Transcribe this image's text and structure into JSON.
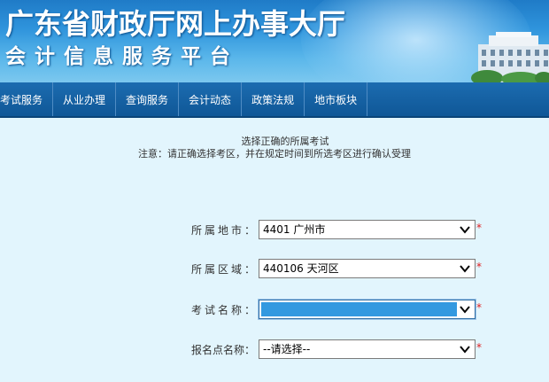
{
  "banner": {
    "title_main": "广东省财政厅网上办事大厅",
    "title_sub": "会计信息服务平台"
  },
  "nav": {
    "items": [
      "考试服务",
      "从业办理",
      "查询服务",
      "会计动态",
      "政策法规",
      "地市板块"
    ]
  },
  "notice": {
    "title": "选择正确的所属考试",
    "note": "注意：请正确选择考区，并在规定时间到所选考区进行确认受理"
  },
  "form": {
    "city": {
      "label": "所属地市：",
      "value": "4401 广州市",
      "required": "*"
    },
    "district": {
      "label": "所属区域：",
      "value": "440106 天河区",
      "required": "*"
    },
    "exam": {
      "label": "考试名称：",
      "value": "",
      "required": "*"
    },
    "site": {
      "label": "报名点名称：",
      "value": "--请选择--",
      "required": "*"
    }
  },
  "colors": {
    "page_bg": "#e2f5fd",
    "nav_bg": "#1c6cb0",
    "required": "#e02020",
    "selection": "#3399e0"
  }
}
